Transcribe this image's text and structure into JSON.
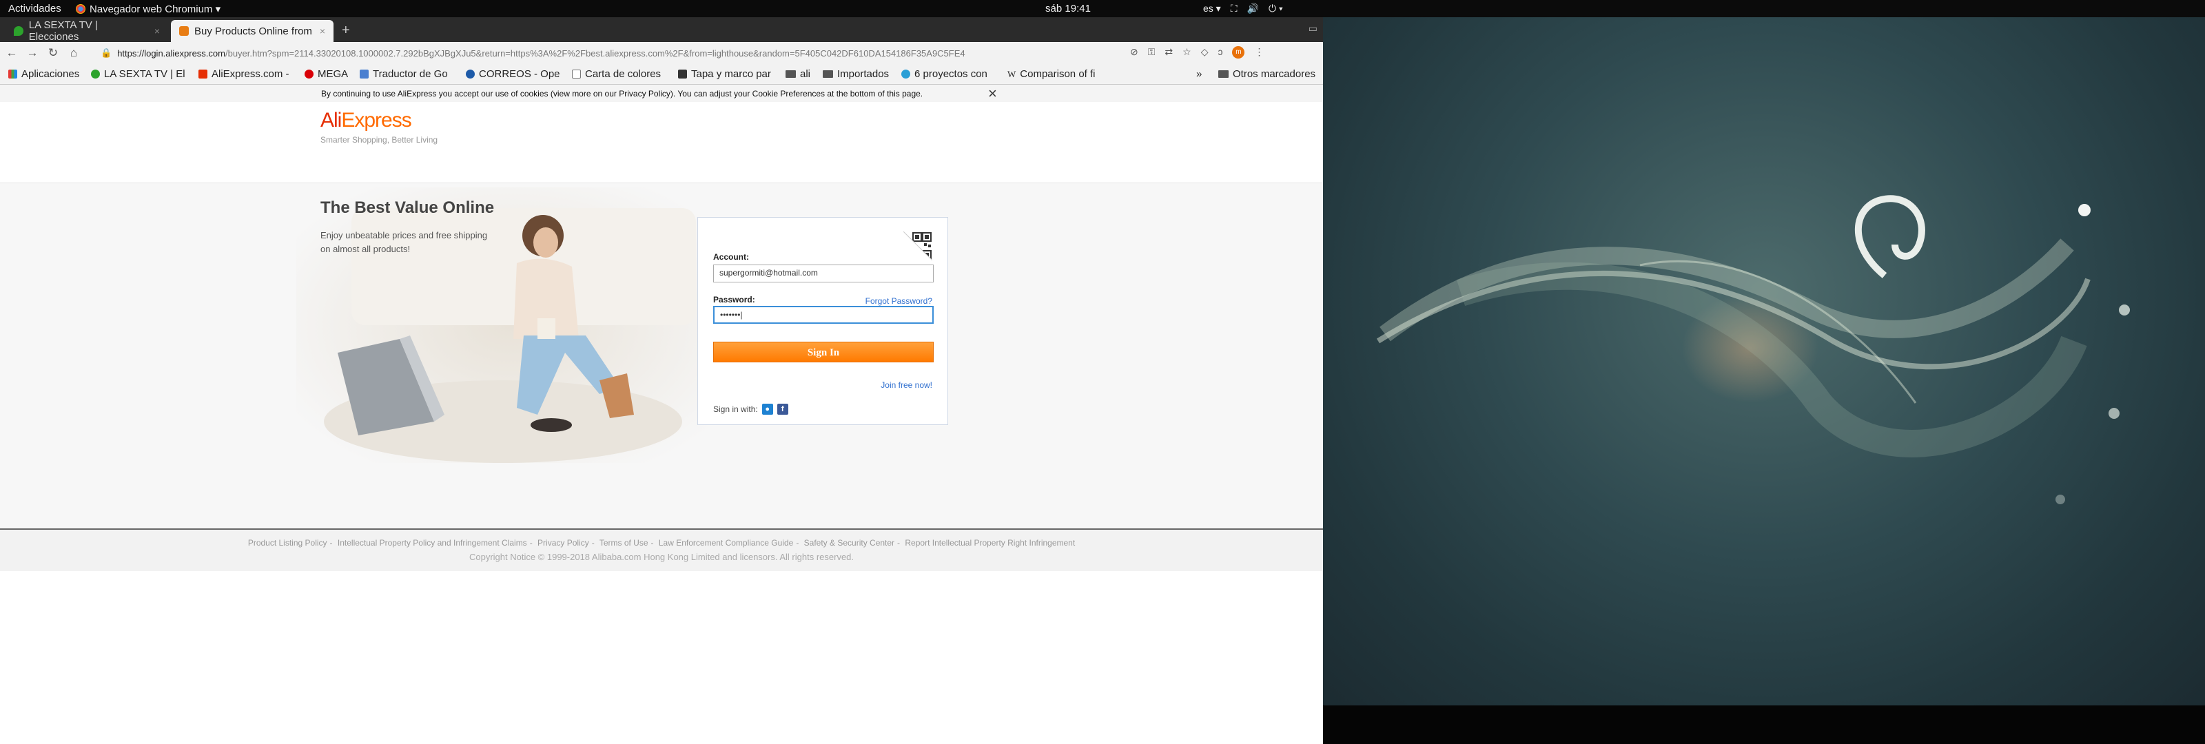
{
  "topbar": {
    "activities": "Actividades",
    "app_menu": "Navegador web Chromium ▾",
    "clock": "sáb 19:41",
    "lang": "es ▾",
    "network_icon": "network-icon",
    "volume_icon": "volume-icon",
    "power_icon": "power-icon"
  },
  "tabs": [
    {
      "label": "LA SEXTA TV | Elecciones",
      "close": "×",
      "favicon_color": "#2ca32c"
    },
    {
      "label": "Buy Products Online from",
      "close": "×",
      "favicon_color": "#e87d14"
    }
  ],
  "new_tab": "+",
  "address": {
    "host": "https://login.aliexpress.com",
    "path": "/buyer.htm?spm=2114.33020108.1000002.7.292bBgXJBgXJu5&return=https%3A%2F%2Fbest.aliexpress.com%2F&from=lighthouse&random=5F405C042DF610DA154186F35A9C5FE4"
  },
  "bookmarks": [
    {
      "label": "Aplicaciones",
      "icon": "apps-grid-icon",
      "color": "#e53935"
    },
    {
      "label": "LA SEXTA TV | El",
      "icon": "lasexta-icon",
      "color": "#2ca32c"
    },
    {
      "label": "AliExpress.com -",
      "icon": "aliexpress-icon",
      "color": "#e62e04"
    },
    {
      "label": "MEGA",
      "icon": "mega-icon",
      "color": "#d90007"
    },
    {
      "label": "Traductor de Go",
      "icon": "translate-icon",
      "color": "#4a7fd0"
    },
    {
      "label": "CORREOS - Ope",
      "icon": "correos-icon",
      "color": "#1d5aa8"
    },
    {
      "label": "Carta de colores",
      "icon": "page-icon",
      "color": "#777777"
    },
    {
      "label": "Tapa y marco par",
      "icon": "film-icon",
      "color": "#333333"
    },
    {
      "label": "ali",
      "icon": "folder-icon",
      "color": "#555555"
    },
    {
      "label": "Importados",
      "icon": "folder-icon",
      "color": "#555555"
    },
    {
      "label": "6 proyectos con",
      "icon": "cloud-icon",
      "color": "#2a9fd6"
    },
    {
      "label": "Comparison of fi",
      "icon": "wikipedia-icon",
      "color": "#333333"
    }
  ],
  "bookmarks_overflow": "»",
  "other_bookmarks": "Otros marcadores",
  "cookie": {
    "text": "By continuing to use AliExpress you accept our use of cookies (view more on our Privacy Policy). You can adjust your Cookie Preferences at the bottom of this page.",
    "close": "×"
  },
  "logo": {
    "ali": "Ali",
    "express": "Express"
  },
  "tagline": "Smarter Shopping, Better Living",
  "hero": {
    "title": "The Best Value Online",
    "subtitle": "Enjoy unbeatable prices and free shipping on almost all products!"
  },
  "login": {
    "account_label": "Account:",
    "account_value": "supergormiti@hotmail.com",
    "password_label": "Password:",
    "password_value": "•••••••|",
    "forgot": "Forgot Password?",
    "sign_in": "Sign In",
    "join": "Join free now!",
    "sign_in_with": "Sign in with:",
    "social": [
      {
        "icon": "qq-icon",
        "color": "#1e82d2"
      },
      {
        "icon": "facebook-icon",
        "color": "#3b5998",
        "glyph": "f"
      }
    ]
  },
  "footer": {
    "links": [
      "Product Listing Policy",
      "Intellectual Property Policy and Infringement Claims",
      "Privacy Policy",
      "Terms of Use",
      "Law Enforcement Compliance Guide",
      "Safety & Security Center",
      "Report Intellectual Property Right Infringement"
    ],
    "separator": "-",
    "copyright": "Copyright Notice © 1999-2018 Alibaba.com Hong Kong Limited and licensors. All rights reserved."
  }
}
